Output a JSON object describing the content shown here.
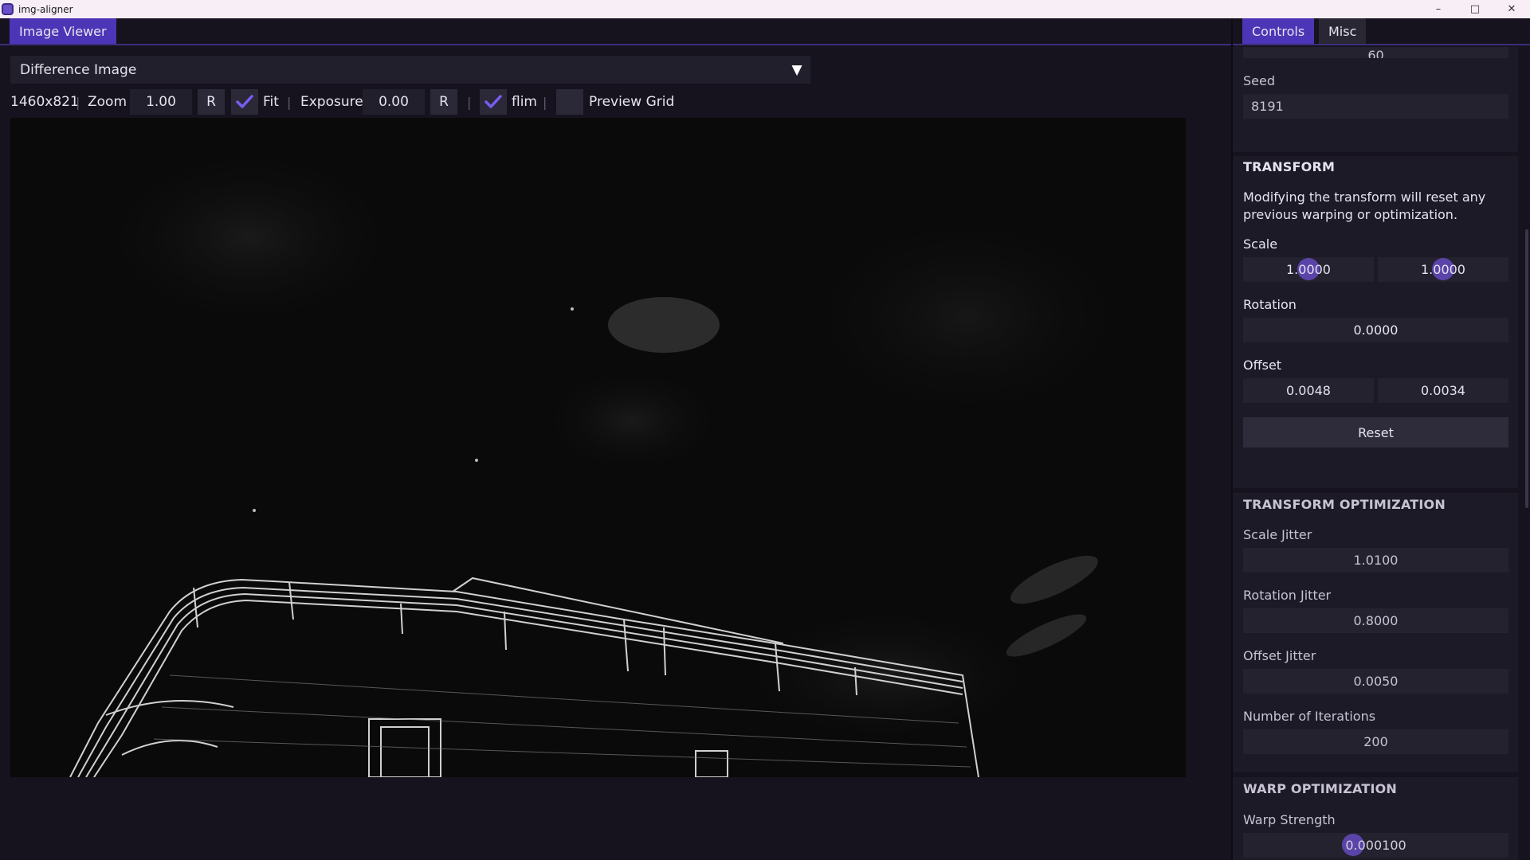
{
  "window": {
    "title": "img-aligner",
    "controls": [
      "–",
      "□",
      "✕"
    ]
  },
  "left": {
    "tab": "Image Viewer",
    "dropdown": {
      "value": "Difference Image",
      "arrow": "▼"
    },
    "toolbar": {
      "resolution": "1460x821",
      "zoom_label": "Zoom",
      "zoom_value": "1.00",
      "zoom_reset": "R",
      "fit_label": "Fit",
      "fit_checked": true,
      "exposure_label": "Exposure",
      "exposure_value": "0.00",
      "exposure_reset": "R",
      "flim_label": "flim",
      "flim_checked": true,
      "preview_grid_label": "Preview Grid",
      "preview_grid_checked": false,
      "separator": "|"
    },
    "image": {
      "description_icon": "difference-image"
    }
  },
  "right": {
    "tabs": [
      {
        "label": "Controls",
        "active": true
      },
      {
        "label": "Misc",
        "active": false
      }
    ],
    "top_partial_value": "60",
    "seed": {
      "label": "Seed",
      "value": "8191"
    },
    "transform": {
      "heading": "TRANSFORM",
      "description": "Modifying the transform will reset any previous warping or optimization.",
      "scale_label": "Scale",
      "scale_x": "1.0000",
      "scale_y": "1.0000",
      "rotation_label": "Rotation",
      "rotation": "0.0000",
      "offset_label": "Offset",
      "offset_x": "0.0048",
      "offset_y": "0.0034",
      "reset_label": "Reset"
    },
    "transform_optimization": {
      "heading": "TRANSFORM OPTIMIZATION",
      "scale_jitter_label": "Scale Jitter",
      "scale_jitter": "1.0100",
      "rotation_jitter_label": "Rotation Jitter",
      "rotation_jitter": "0.8000",
      "offset_jitter_label": "Offset Jitter",
      "offset_jitter": "0.0050",
      "iterations_label": "Number of Iterations",
      "iterations": "200"
    },
    "warp_optimization": {
      "heading": "WARP OPTIMIZATION",
      "warp_strength_label": "Warp Strength",
      "warp_strength": "0.000100"
    }
  },
  "colors": {
    "accent": "#4d35b7",
    "check": "#7a5cf0",
    "background": "#16131f"
  }
}
